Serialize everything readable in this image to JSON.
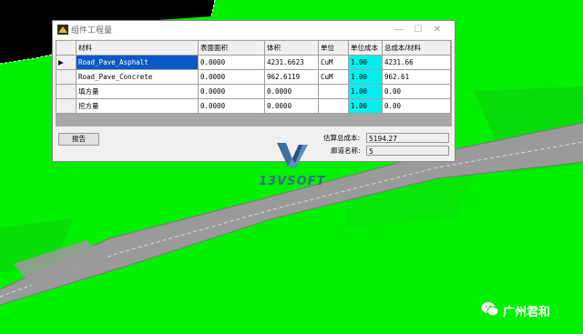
{
  "window": {
    "title": "组件工程量",
    "controls": {
      "minimize": "—",
      "maximize": "☐",
      "close": "✕"
    }
  },
  "table": {
    "columns": [
      "材料",
      "表面面积",
      "体积",
      "单位",
      "单位成本",
      "总成本/材料"
    ],
    "current_row_marker": "▶",
    "rows": [
      [
        "Road_Pave_Asphalt",
        "0.0000",
        "4231.6623",
        "CuM",
        "1.00",
        "4231.66"
      ],
      [
        "Road_Pave_Concrete",
        "0.0000",
        "962.6119",
        "CuM",
        "1.00",
        "962.61"
      ],
      [
        "填方量",
        "0.0000",
        "0.0000",
        "",
        "1.00",
        "0.00"
      ],
      [
        "挖方量",
        "0.0000",
        "0.0000",
        "",
        "1.00",
        "0.00"
      ]
    ]
  },
  "report_button": "报告",
  "summary": {
    "total_cost_label": "估算总成本:",
    "total_cost_value": "5194.27",
    "corridor_label": "廊道名称:",
    "corridor_value": "5"
  },
  "logo": {
    "text": "13VSOFT"
  },
  "watermark": {
    "text": "广州君和"
  },
  "colors": {
    "background": "#00f000",
    "selection": "#0a58c6",
    "unit_cost_cell": "#00f0f0"
  }
}
